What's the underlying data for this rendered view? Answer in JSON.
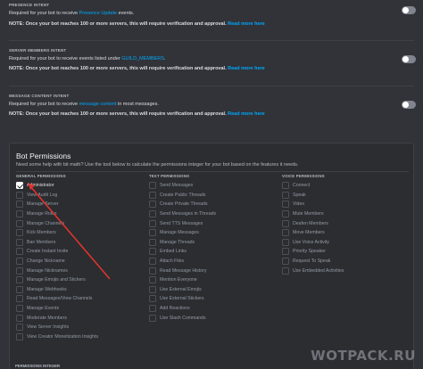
{
  "intents": [
    {
      "title": "PRESENCE INTENT",
      "desc_prefix": "Required for your bot to receive ",
      "desc_link": "Presence Update",
      "desc_suffix": " events.",
      "note_prefix": "NOTE: Once your bot reaches 100 or more servers, this will require verification and approval.",
      "note_link": "Read more here",
      "enabled": false
    },
    {
      "title": "SERVER MEMBERS INTENT",
      "desc_prefix": "Required for your bot to receive events listed under ",
      "desc_link": "GUILD_MEMBERS",
      "desc_suffix": ".",
      "note_prefix": "NOTE: Once your bot reaches 100 or more servers, this will require verification and approval.",
      "note_link": "Read more here",
      "enabled": false
    },
    {
      "title": "MESSAGE CONTENT INTENT",
      "desc_prefix": "Required for your bot to receive ",
      "desc_link": "message content",
      "desc_suffix": " in most messages.",
      "note_prefix": "NOTE: Once your bot reaches 100 or more servers, this will require verification and approval.",
      "note_link": "Read more here",
      "enabled": false
    }
  ],
  "bot_permissions": {
    "title": "Bot Permissions",
    "help": "Need some help with bit math? Use the tool below to calculate the permissions integer for your bot based on the features it needs.",
    "columns": [
      {
        "heading": "GENERAL PERMISSIONS",
        "items": [
          {
            "label": "Administrator",
            "checked": true
          },
          {
            "label": "View Audit Log",
            "checked": false
          },
          {
            "label": "Manage Server",
            "checked": false
          },
          {
            "label": "Manage Roles",
            "checked": false
          },
          {
            "label": "Manage Channels",
            "checked": false
          },
          {
            "label": "Kick Members",
            "checked": false
          },
          {
            "label": "Ban Members",
            "checked": false
          },
          {
            "label": "Create Instant Invite",
            "checked": false
          },
          {
            "label": "Change Nickname",
            "checked": false
          },
          {
            "label": "Manage Nicknames",
            "checked": false
          },
          {
            "label": "Manage Emojis and Stickers",
            "checked": false
          },
          {
            "label": "Manage Webhooks",
            "checked": false
          },
          {
            "label": "Read Messages/View Channels",
            "checked": false
          },
          {
            "label": "Manage Events",
            "checked": false
          },
          {
            "label": "Moderate Members",
            "checked": false
          },
          {
            "label": "View Server Insights",
            "checked": false
          },
          {
            "label": "View Creator Monetization Insights",
            "checked": false
          }
        ]
      },
      {
        "heading": "TEXT PERMISSIONS",
        "items": [
          {
            "label": "Send Messages",
            "checked": false
          },
          {
            "label": "Create Public Threads",
            "checked": false
          },
          {
            "label": "Create Private Threads",
            "checked": false
          },
          {
            "label": "Send Messages in Threads",
            "checked": false
          },
          {
            "label": "Send TTS Messages",
            "checked": false
          },
          {
            "label": "Manage Messages",
            "checked": false
          },
          {
            "label": "Manage Threads",
            "checked": false
          },
          {
            "label": "Embed Links",
            "checked": false
          },
          {
            "label": "Attach Files",
            "checked": false
          },
          {
            "label": "Read Message History",
            "checked": false
          },
          {
            "label": "Mention Everyone",
            "checked": false
          },
          {
            "label": "Use External Emojis",
            "checked": false
          },
          {
            "label": "Use External Stickers",
            "checked": false
          },
          {
            "label": "Add Reactions",
            "checked": false
          },
          {
            "label": "Use Slash Commands",
            "checked": false
          }
        ]
      },
      {
        "heading": "VOICE PERMISSIONS",
        "items": [
          {
            "label": "Connect",
            "checked": false
          },
          {
            "label": "Speak",
            "checked": false
          },
          {
            "label": "Video",
            "checked": false
          },
          {
            "label": "Mute Members",
            "checked": false
          },
          {
            "label": "Deafen Members",
            "checked": false
          },
          {
            "label": "Move Members",
            "checked": false
          },
          {
            "label": "Use Voice Activity",
            "checked": false
          },
          {
            "label": "Priority Speaker",
            "checked": false
          },
          {
            "label": "Request To Speak",
            "checked": false
          },
          {
            "label": "Use Embedded Activities",
            "checked": false
          }
        ]
      }
    ]
  },
  "permissions_integer_heading": "PERMISSIONS INTEGER",
  "watermark": "WOTPACK.RU",
  "colors": {
    "background": "#313338",
    "panel": "#2b2d31",
    "link": "#00a8fc",
    "arrow": "#e0332d",
    "toggle_off": "#80848e"
  }
}
